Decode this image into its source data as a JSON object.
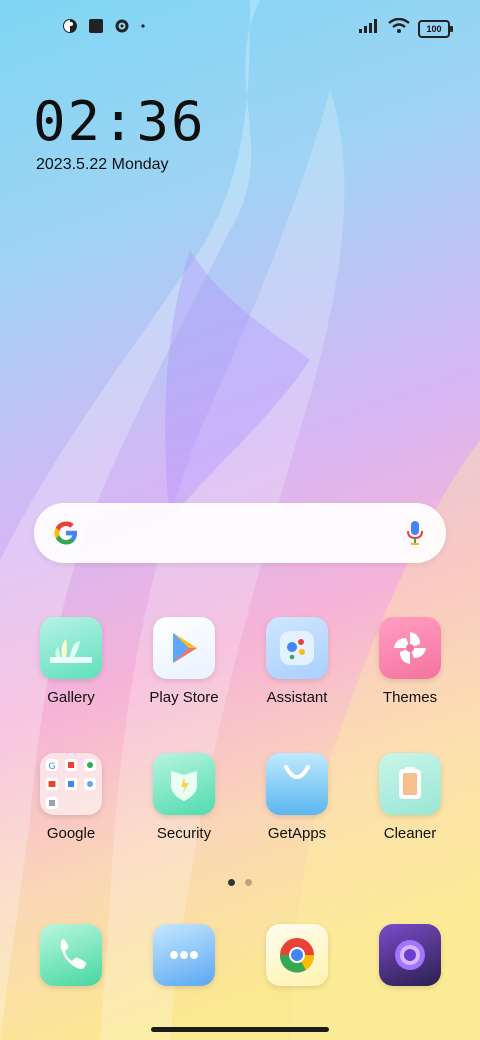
{
  "status_bar": {
    "icons_left": [
      "vpn-icon",
      "notification-square-icon",
      "gear-icon",
      "dot-icon"
    ],
    "battery_level": "100"
  },
  "clock": {
    "time": "02:36",
    "date": "2023.5.22 Monday"
  },
  "apps_row1": [
    {
      "label": "Gallery",
      "icon": "gallery-icon"
    },
    {
      "label": "Play Store",
      "icon": "play-store-icon"
    },
    {
      "label": "Assistant",
      "icon": "assistant-icon"
    },
    {
      "label": "Themes",
      "icon": "themes-icon"
    }
  ],
  "apps_row2": [
    {
      "label": "Google",
      "icon": "google-folder-icon"
    },
    {
      "label": "Security",
      "icon": "security-icon"
    },
    {
      "label": "GetApps",
      "icon": "getapps-icon"
    },
    {
      "label": "Cleaner",
      "icon": "cleaner-icon"
    }
  ],
  "dock": [
    {
      "icon": "phone-icon"
    },
    {
      "icon": "messages-icon"
    },
    {
      "icon": "chrome-icon"
    },
    {
      "icon": "camera-icon"
    }
  ],
  "pager": {
    "pages": 2,
    "active": 1
  }
}
